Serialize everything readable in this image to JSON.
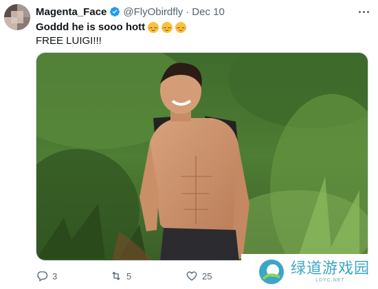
{
  "tweet": {
    "author": {
      "display_name": "Magenta_Face",
      "handle": "@FlyObirdfly",
      "separator": "·",
      "date": "Dec 10",
      "verified": true
    },
    "text_line1": "Goddd he is sooo hott",
    "emojis": [
      "relieved-face",
      "relieved-face",
      "relieved-face"
    ],
    "text_line2": "FREE LUIGI!!!",
    "media": {
      "kind": "photo"
    },
    "actions": {
      "replies": "3",
      "reposts": "5",
      "likes": "25"
    }
  },
  "watermark": {
    "brand": "绿道游戏园",
    "site": "LDYC.NET"
  },
  "colors": {
    "text": "#0f1419",
    "secondary": "#536471",
    "verified": "#1d9bf0",
    "watermark": "#3aa6c8"
  }
}
